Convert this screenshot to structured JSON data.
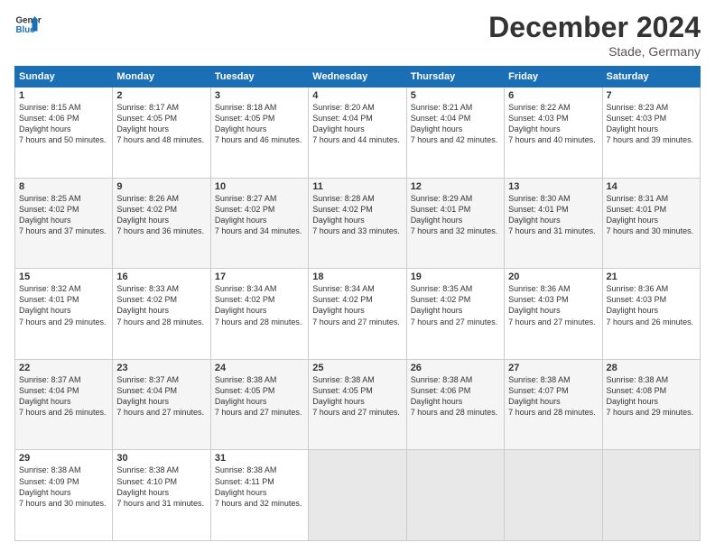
{
  "header": {
    "logo_line1": "General",
    "logo_line2": "Blue",
    "month_year": "December 2024",
    "location": "Stade, Germany"
  },
  "weekdays": [
    "Sunday",
    "Monday",
    "Tuesday",
    "Wednesday",
    "Thursday",
    "Friday",
    "Saturday"
  ],
  "weeks": [
    [
      {
        "day": "1",
        "sunrise": "8:15 AM",
        "sunset": "4:06 PM",
        "daylight": "7 hours and 50 minutes."
      },
      {
        "day": "2",
        "sunrise": "8:17 AM",
        "sunset": "4:05 PM",
        "daylight": "7 hours and 48 minutes."
      },
      {
        "day": "3",
        "sunrise": "8:18 AM",
        "sunset": "4:05 PM",
        "daylight": "7 hours and 46 minutes."
      },
      {
        "day": "4",
        "sunrise": "8:20 AM",
        "sunset": "4:04 PM",
        "daylight": "7 hours and 44 minutes."
      },
      {
        "day": "5",
        "sunrise": "8:21 AM",
        "sunset": "4:04 PM",
        "daylight": "7 hours and 42 minutes."
      },
      {
        "day": "6",
        "sunrise": "8:22 AM",
        "sunset": "4:03 PM",
        "daylight": "7 hours and 40 minutes."
      },
      {
        "day": "7",
        "sunrise": "8:23 AM",
        "sunset": "4:03 PM",
        "daylight": "7 hours and 39 minutes."
      }
    ],
    [
      {
        "day": "8",
        "sunrise": "8:25 AM",
        "sunset": "4:02 PM",
        "daylight": "7 hours and 37 minutes."
      },
      {
        "day": "9",
        "sunrise": "8:26 AM",
        "sunset": "4:02 PM",
        "daylight": "7 hours and 36 minutes."
      },
      {
        "day": "10",
        "sunrise": "8:27 AM",
        "sunset": "4:02 PM",
        "daylight": "7 hours and 34 minutes."
      },
      {
        "day": "11",
        "sunrise": "8:28 AM",
        "sunset": "4:02 PM",
        "daylight": "7 hours and 33 minutes."
      },
      {
        "day": "12",
        "sunrise": "8:29 AM",
        "sunset": "4:01 PM",
        "daylight": "7 hours and 32 minutes."
      },
      {
        "day": "13",
        "sunrise": "8:30 AM",
        "sunset": "4:01 PM",
        "daylight": "7 hours and 31 minutes."
      },
      {
        "day": "14",
        "sunrise": "8:31 AM",
        "sunset": "4:01 PM",
        "daylight": "7 hours and 30 minutes."
      }
    ],
    [
      {
        "day": "15",
        "sunrise": "8:32 AM",
        "sunset": "4:01 PM",
        "daylight": "7 hours and 29 minutes."
      },
      {
        "day": "16",
        "sunrise": "8:33 AM",
        "sunset": "4:02 PM",
        "daylight": "7 hours and 28 minutes."
      },
      {
        "day": "17",
        "sunrise": "8:34 AM",
        "sunset": "4:02 PM",
        "daylight": "7 hours and 28 minutes."
      },
      {
        "day": "18",
        "sunrise": "8:34 AM",
        "sunset": "4:02 PM",
        "daylight": "7 hours and 27 minutes."
      },
      {
        "day": "19",
        "sunrise": "8:35 AM",
        "sunset": "4:02 PM",
        "daylight": "7 hours and 27 minutes."
      },
      {
        "day": "20",
        "sunrise": "8:36 AM",
        "sunset": "4:03 PM",
        "daylight": "7 hours and 27 minutes."
      },
      {
        "day": "21",
        "sunrise": "8:36 AM",
        "sunset": "4:03 PM",
        "daylight": "7 hours and 26 minutes."
      }
    ],
    [
      {
        "day": "22",
        "sunrise": "8:37 AM",
        "sunset": "4:04 PM",
        "daylight": "7 hours and 26 minutes."
      },
      {
        "day": "23",
        "sunrise": "8:37 AM",
        "sunset": "4:04 PM",
        "daylight": "7 hours and 27 minutes."
      },
      {
        "day": "24",
        "sunrise": "8:38 AM",
        "sunset": "4:05 PM",
        "daylight": "7 hours and 27 minutes."
      },
      {
        "day": "25",
        "sunrise": "8:38 AM",
        "sunset": "4:05 PM",
        "daylight": "7 hours and 27 minutes."
      },
      {
        "day": "26",
        "sunrise": "8:38 AM",
        "sunset": "4:06 PM",
        "daylight": "7 hours and 28 minutes."
      },
      {
        "day": "27",
        "sunrise": "8:38 AM",
        "sunset": "4:07 PM",
        "daylight": "7 hours and 28 minutes."
      },
      {
        "day": "28",
        "sunrise": "8:38 AM",
        "sunset": "4:08 PM",
        "daylight": "7 hours and 29 minutes."
      }
    ],
    [
      {
        "day": "29",
        "sunrise": "8:38 AM",
        "sunset": "4:09 PM",
        "daylight": "7 hours and 30 minutes."
      },
      {
        "day": "30",
        "sunrise": "8:38 AM",
        "sunset": "4:10 PM",
        "daylight": "7 hours and 31 minutes."
      },
      {
        "day": "31",
        "sunrise": "8:38 AM",
        "sunset": "4:11 PM",
        "daylight": "7 hours and 32 minutes."
      },
      null,
      null,
      null,
      null
    ]
  ]
}
